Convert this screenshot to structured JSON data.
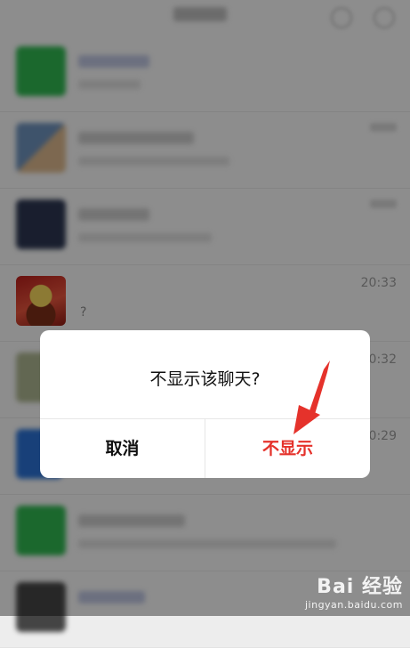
{
  "chat_list": [
    {
      "avatar_color": "#2fb34f",
      "time": "",
      "message": ""
    },
    {
      "avatar_color": "#6c8fb8",
      "time": "",
      "message": ""
    },
    {
      "avatar_color": "#2b3550",
      "time": "",
      "message": ""
    },
    {
      "avatar_color": "#c0261c",
      "time": "20:33",
      "message": "?"
    },
    {
      "avatar_color": "#a9b18d",
      "time": "20:32",
      "message": ""
    },
    {
      "avatar_color": "#2a6fd0",
      "time": "20:29",
      "message": ""
    },
    {
      "avatar_color": "#2fb34f",
      "time": "",
      "message": ""
    },
    {
      "avatar_color": "#444444",
      "time": "",
      "message": ""
    }
  ],
  "dialog": {
    "message": "不显示该聊天?",
    "cancel_label": "取消",
    "confirm_label": "不显示",
    "confirm_color": "#e5322b"
  },
  "watermark": {
    "brand": "Bai  经验",
    "url": "jingyan.baidu.com"
  }
}
